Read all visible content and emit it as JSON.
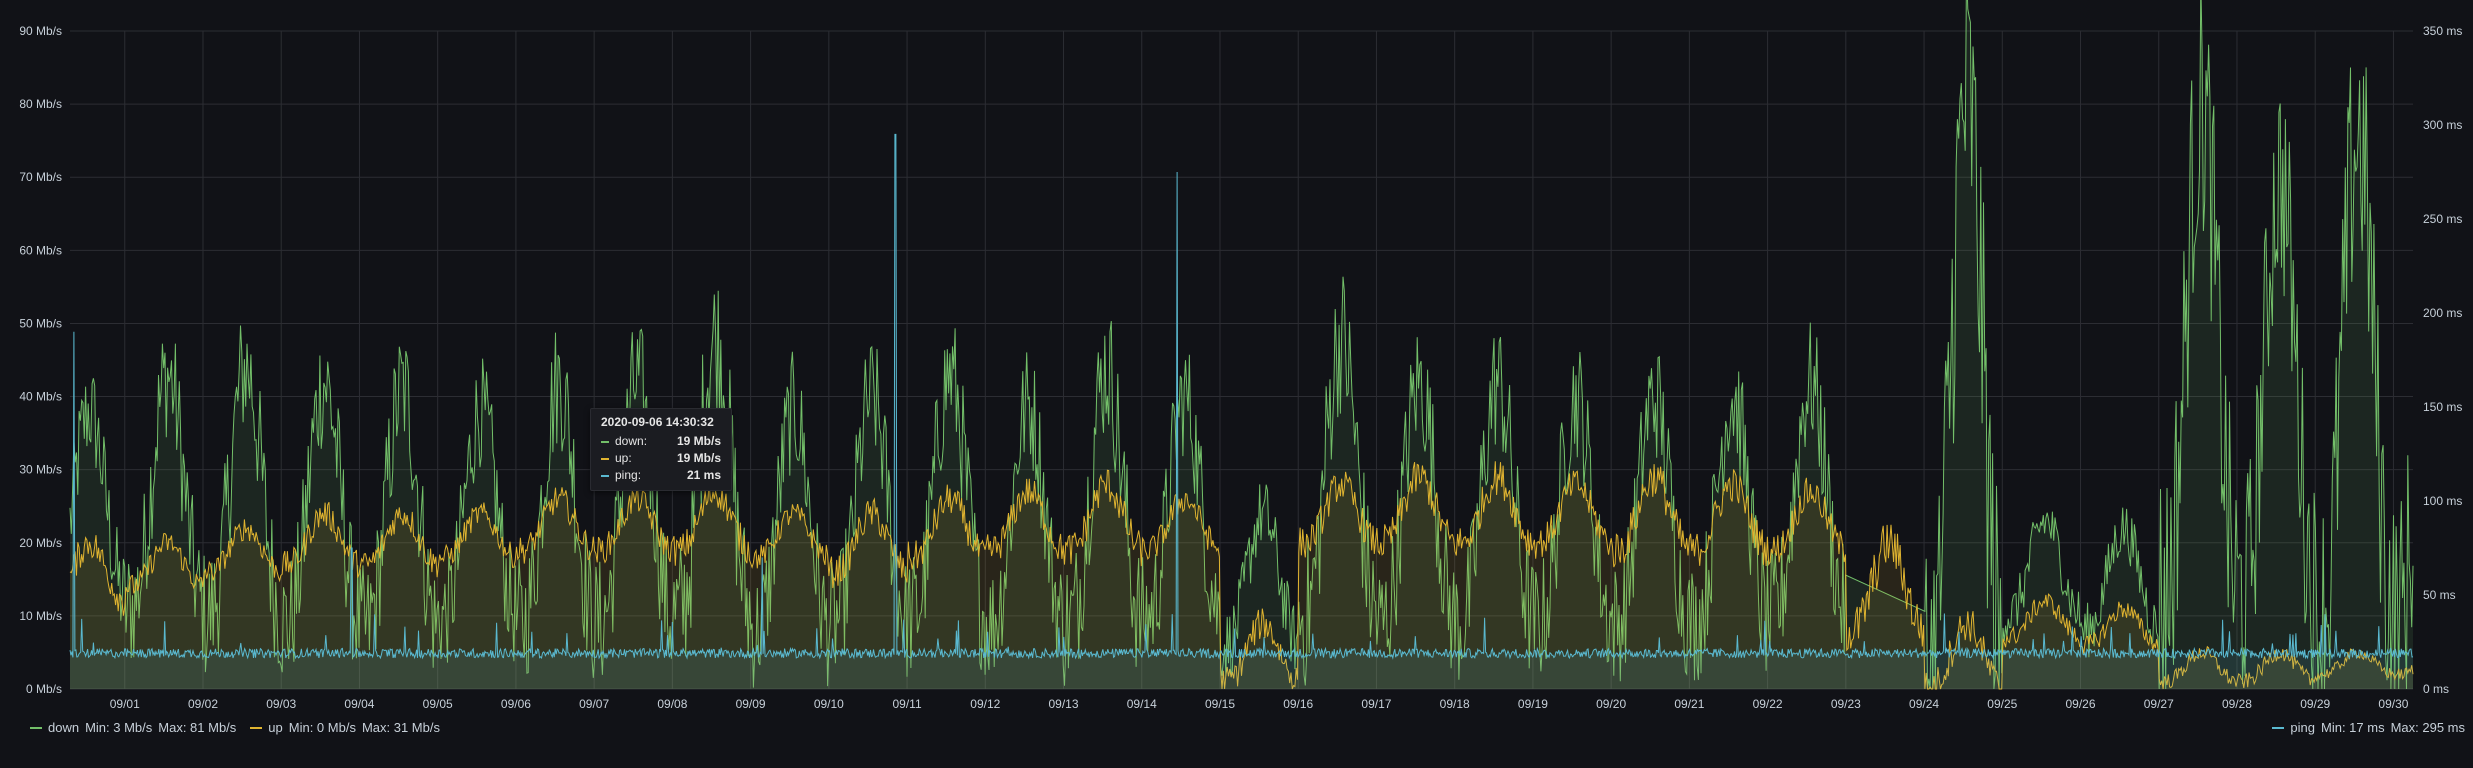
{
  "chart_data": {
    "type": "line",
    "x_ticks": [
      "09/01",
      "09/02",
      "09/03",
      "09/04",
      "09/05",
      "09/06",
      "09/07",
      "09/08",
      "09/09",
      "09/10",
      "09/11",
      "09/12",
      "09/13",
      "09/14",
      "09/15",
      "09/16",
      "09/17",
      "09/18",
      "09/19",
      "09/20",
      "09/21",
      "09/22",
      "09/23",
      "09/24",
      "09/25",
      "09/26",
      "09/27",
      "09/28",
      "09/29",
      "09/30"
    ],
    "x_range_days": [
      0.3,
      30.25
    ],
    "y_left": {
      "ticks": [
        "0 Mb/s",
        "10 Mb/s",
        "20 Mb/s",
        "30 Mb/s",
        "40 Mb/s",
        "50 Mb/s",
        "60 Mb/s",
        "70 Mb/s",
        "80 Mb/s",
        "90 Mb/s"
      ],
      "range": [
        0,
        90
      ],
      "unit": "Mb/s"
    },
    "y_right": {
      "ticks": [
        "0 ms",
        "50 ms",
        "100 ms",
        "150 ms",
        "200 ms",
        "250 ms",
        "300 ms",
        "350 ms"
      ],
      "range": [
        0,
        350
      ],
      "unit": "ms"
    },
    "grid": true,
    "series": [
      {
        "name": "down",
        "axis": "left",
        "color": "#73bf69",
        "fill": true,
        "daily_peak": [
          38,
          43,
          44,
          42,
          41,
          38,
          42,
          42,
          48,
          38,
          40,
          43,
          39,
          44,
          40,
          24,
          48,
          42,
          42,
          40,
          40,
          40,
          42,
          0,
          81,
          23,
          22,
          80,
          70,
          76
        ],
        "daily_base": [
          12,
          11,
          10,
          9,
          8,
          10,
          9,
          9,
          10,
          8,
          9,
          10,
          9,
          9,
          10,
          6,
          10,
          9,
          9,
          9,
          9,
          9,
          10,
          18,
          2,
          10,
          8,
          13,
          13,
          9
        ]
      },
      {
        "name": "up",
        "axis": "left",
        "color": "#e0b430",
        "fill": true,
        "daily_peak": [
          20,
          20,
          22,
          24,
          24,
          24,
          26,
          26,
          27,
          24,
          24,
          26,
          27,
          28,
          26,
          9,
          28,
          29,
          29,
          28,
          29,
          28,
          27,
          20,
          9,
          12,
          11,
          5,
          5,
          5
        ],
        "daily_base": [
          12,
          14,
          16,
          17,
          17,
          18,
          19,
          19,
          19,
          18,
          16,
          18,
          19,
          19,
          19,
          1,
          20,
          20,
          20,
          20,
          19,
          19,
          19,
          8,
          0,
          7,
          6,
          1,
          1,
          2
        ]
      },
      {
        "name": "ping",
        "axis": "right",
        "color": "#5ab9d0",
        "fill": true,
        "baseline_ms": 19,
        "spikes": [
          {
            "day": 0.35,
            "ms": 190
          },
          {
            "day": 10.85,
            "ms": 295
          },
          {
            "day": 14.45,
            "ms": 275
          },
          {
            "day": 9.15,
            "ms": 70
          },
          {
            "day": 3.9,
            "ms": 75
          }
        ]
      }
    ],
    "legend": {
      "down": {
        "label": "down",
        "min": "Min: 3 Mb/s",
        "max": "Max: 81 Mb/s"
      },
      "up": {
        "label": "up",
        "min": "Min: 0 Mb/s",
        "max": "Max: 31 Mb/s"
      },
      "ping": {
        "label": "ping",
        "min": "Min: 17 ms",
        "max": "Max: 295 ms"
      }
    },
    "tooltip": {
      "time": "2020-09-06 14:30:32",
      "rows": [
        {
          "name": "down:",
          "value": "19 Mb/s",
          "color": "#73bf69"
        },
        {
          "name": "up:",
          "value": "19 Mb/s",
          "color": "#e0b430"
        },
        {
          "name": "ping:",
          "value": "21 ms",
          "color": "#5ab9d0"
        }
      ]
    }
  }
}
